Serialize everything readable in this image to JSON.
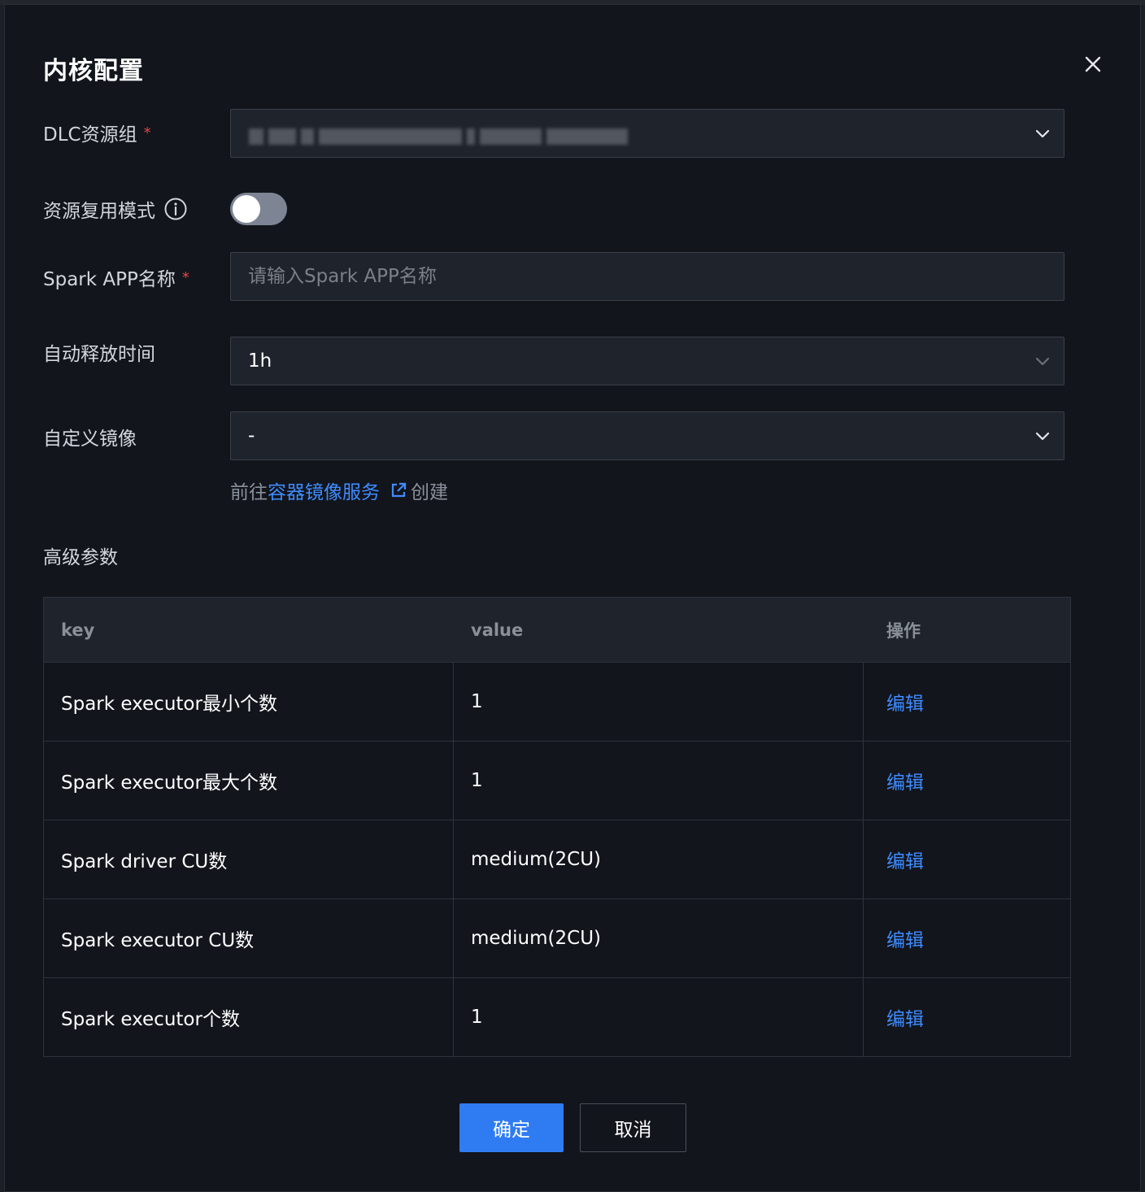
{
  "dialog": {
    "title": "内核配置"
  },
  "form": {
    "resource_group": {
      "label": "DLC资源组",
      "required": "*",
      "value": ""
    },
    "reuse_mode": {
      "label": "资源复用模式",
      "enabled": false
    },
    "app_name": {
      "label": "Spark APP名称",
      "required": "*",
      "placeholder": "请输入Spark APP名称",
      "value": ""
    },
    "release_time": {
      "label": "自动释放时间",
      "value": "1h"
    },
    "custom_image": {
      "label": "自定义镜像",
      "value": "-",
      "hint_prefix": "前往",
      "hint_link": "容器镜像服务",
      "hint_suffix": "创建"
    }
  },
  "advanced": {
    "title": "高级参数",
    "columns": [
      "key",
      "value",
      "操作"
    ],
    "rows": [
      {
        "key": "Spark executor最小个数",
        "value": "1",
        "action": "编辑"
      },
      {
        "key": "Spark executor最大个数",
        "value": "1",
        "action": "编辑"
      },
      {
        "key": "Spark driver CU数",
        "value": "medium(2CU)",
        "action": "编辑"
      },
      {
        "key": "Spark executor CU数",
        "value": "medium(2CU)",
        "action": "编辑"
      },
      {
        "key": "Spark executor个数",
        "value": "1",
        "action": "编辑"
      }
    ]
  },
  "footer": {
    "confirm_label": "确定",
    "cancel_label": "取消"
  },
  "colors": {
    "accent": "#2f7bf2",
    "link": "#3f8cff",
    "required": "#e54545",
    "dialog_bg": "#12151c"
  },
  "icons": {
    "close": "close-icon",
    "info": "info-icon",
    "chevron": "chevron-down-icon",
    "external_link": "external-link-icon"
  }
}
